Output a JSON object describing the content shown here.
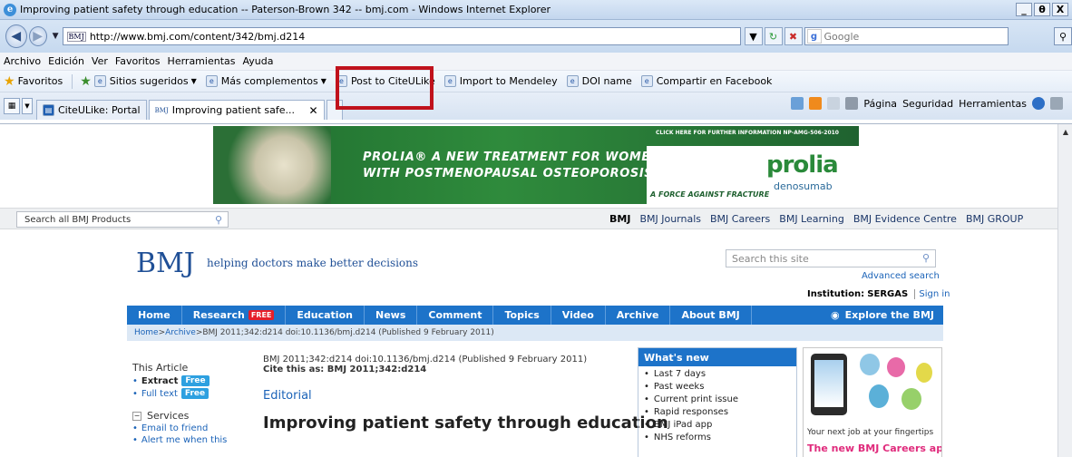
{
  "window": {
    "title": "Improving patient safety through education -- Paterson-Brown 342 -- bmj.com - Windows Internet Explorer",
    "min": "_",
    "max": "θ",
    "close": "X"
  },
  "address": {
    "favicon": "BMJ",
    "url": "http://www.bmj.com/content/342/bmj.d214",
    "search_placeholder": "Google"
  },
  "menu": [
    "Archivo",
    "Edición",
    "Ver",
    "Favoritos",
    "Herramientas",
    "Ayuda"
  ],
  "favorites": {
    "label": "Favoritos",
    "items": [
      "Sitios sugeridos",
      "Más complementos",
      "Post to CiteULike",
      "Import to Mendeley",
      "DOI name",
      "Compartir en Facebook"
    ]
  },
  "tabs": {
    "items": [
      "CiteULike: Portal",
      "Improving patient safe..."
    ]
  },
  "commandbar": {
    "page": "Página",
    "security": "Seguridad",
    "tools": "Herramientas"
  },
  "banner": {
    "click_here": "CLICK HERE FOR FURTHER INFORMATION   NP-AMG-506-2010",
    "line1": "PROLIA® A NEW TREATMENT FOR WOMEN",
    "line2": "WITH POSTMENOPAUSAL OSTEOPOROSIS",
    "fight": "A FORCE AGAINST FRACTURE",
    "brand": "prolia",
    "generic": "denosumab"
  },
  "portal": {
    "search_placeholder": "Search all BMJ Products",
    "links": [
      "BMJ",
      "BMJ Journals",
      "BMJ Careers",
      "BMJ Learning",
      "BMJ Evidence Centre",
      "BMJ GROUP"
    ]
  },
  "header": {
    "logo": "BMJ",
    "tagline": "helping doctors make better decisions",
    "search_placeholder": "Search this site",
    "advanced": "Advanced search",
    "institution_label": "Institution:",
    "institution": "SERGAS",
    "signin": "Sign in"
  },
  "nav": {
    "items": [
      "Home",
      "Research",
      "Education",
      "News",
      "Comment",
      "Topics",
      "Video",
      "Archive",
      "About BMJ"
    ],
    "free_badge": "FREE",
    "explore": "Explore the BMJ"
  },
  "breadcrumb": {
    "home": "Home",
    "sep1": " > ",
    "archive": "Archive",
    "rest": " >BMJ 2011;342:d214 doi:10.1136/bmj.d214 (Published 9 February 2011)"
  },
  "sidebar": {
    "heading": "This Article",
    "extract": "Extract",
    "fulltext": "Full text",
    "free": "Free",
    "services": "Services",
    "email": "Email to friend",
    "alert": "Alert me when this"
  },
  "article": {
    "citation": "BMJ 2011;342:d214 doi:10.1136/bmj.d214 (Published 9 February 2011)",
    "cite_as": "Cite this as: BMJ 2011;342:d214",
    "section": "Editorial",
    "title": "Improving patient safety through education"
  },
  "whatsnew": {
    "heading": "What's new",
    "items": [
      "Last 7 days",
      "Past weeks",
      "Current print issue",
      "Rapid responses",
      "BMJ iPad app",
      "NHS reforms"
    ]
  },
  "careers_ad": {
    "line1": "Your next job at your fingertips",
    "line2": "The new BMJ Careers app"
  }
}
